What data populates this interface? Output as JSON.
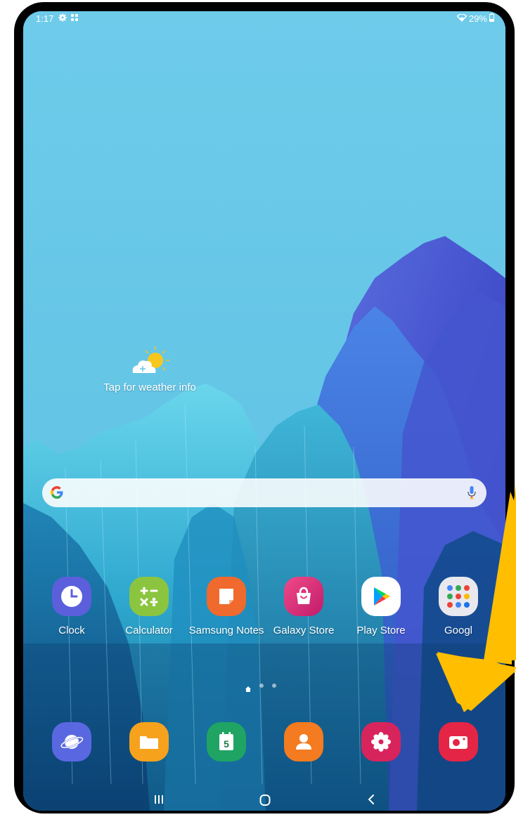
{
  "status_bar": {
    "time": "1:17",
    "battery": "29%",
    "icons": [
      "settings-gear-icon",
      "apps-grid-icon",
      "wifi-icon",
      "battery-icon"
    ]
  },
  "weather": {
    "label": "Tap for weather info",
    "icon": "sun-cloud-icon"
  },
  "search": {
    "icons": [
      "google-logo-icon",
      "microphone-icon"
    ]
  },
  "apps": [
    {
      "label": "Clock",
      "icon": "clock-icon",
      "color": "#5b5fdc"
    },
    {
      "label": "Calculator",
      "icon": "calculator-icon",
      "color": "#8bc53f"
    },
    {
      "label": "Samsung Notes",
      "icon": "notes-icon",
      "color": "#ef6a2c"
    },
    {
      "label": "Galaxy Store",
      "icon": "store-bag-icon",
      "color": "#e8317a"
    },
    {
      "label": "Play Store",
      "icon": "play-store-icon",
      "color": "#ffffff"
    },
    {
      "label": "Googl",
      "icon": "google-folder-icon",
      "color": "#e8e8ee"
    }
  ],
  "dock": [
    {
      "name": "internet",
      "icon": "internet-planet-icon",
      "color": "#5968e0"
    },
    {
      "name": "my-files",
      "icon": "folder-icon",
      "color": "#f6a21d"
    },
    {
      "name": "calendar",
      "icon": "calendar-icon",
      "color": "#1fa463",
      "text": "5"
    },
    {
      "name": "contacts",
      "icon": "contacts-icon",
      "color": "#f47b1f"
    },
    {
      "name": "gallery",
      "icon": "gallery-flower-icon",
      "color": "#d8245c"
    },
    {
      "name": "camera",
      "icon": "camera-icon",
      "color": "#e52545"
    }
  ],
  "navigation": [
    "recent-apps-icon",
    "home-icon",
    "back-icon"
  ],
  "annotation": {
    "arrow_color": "#ffbe00",
    "points_to": "camera"
  }
}
